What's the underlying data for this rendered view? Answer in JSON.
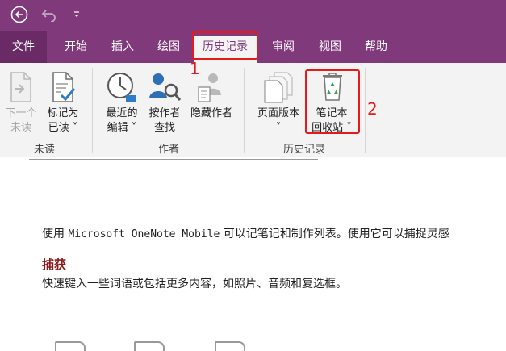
{
  "titlebar": {
    "back_icon": "back-circle-icon",
    "undo_icon": "undo-icon",
    "qat_icon": "customize-quick-access-icon"
  },
  "tabs": [
    {
      "label": "文件"
    },
    {
      "label": "开始"
    },
    {
      "label": "插入"
    },
    {
      "label": "绘图"
    },
    {
      "label": "历史记录"
    },
    {
      "label": "审阅"
    },
    {
      "label": "视图"
    },
    {
      "label": "帮助"
    }
  ],
  "ribbon": {
    "unread_group": {
      "label": "未读",
      "next_unread": {
        "line1": "下一个",
        "line2": "未读"
      },
      "mark_read": {
        "line1": "标记为",
        "line2": "已读 ˅"
      }
    },
    "author_group": {
      "label": "作者",
      "recent_edits": {
        "line1": "最近的",
        "line2": "编辑 ˅"
      },
      "find_by_author": {
        "line1": "按作者",
        "line2": "查找"
      },
      "hide_authors": {
        "line1": "隐藏作者"
      }
    },
    "history_group": {
      "label": "历史记录",
      "page_versions": {
        "line1": "页面版本",
        "line2": "˅"
      },
      "recycle_bin": {
        "line1": "笔记本",
        "line2": "回收站 ˅"
      }
    }
  },
  "annotations": {
    "one": "1",
    "two": "2"
  },
  "page": {
    "para1_prefix": "使用 ",
    "para1_app": "Microsoft OneNote Mobile",
    "para1_suffix": " 可以记笔记和制作列表。使用它可以捕捉灵感",
    "heading": "捕获",
    "para2": "快速键入一些词语或包括更多内容，如照片、音频和复选框。"
  },
  "colors": {
    "brand": "#80397b",
    "annotation": "#e8191b",
    "heading": "#8b1a1a"
  }
}
